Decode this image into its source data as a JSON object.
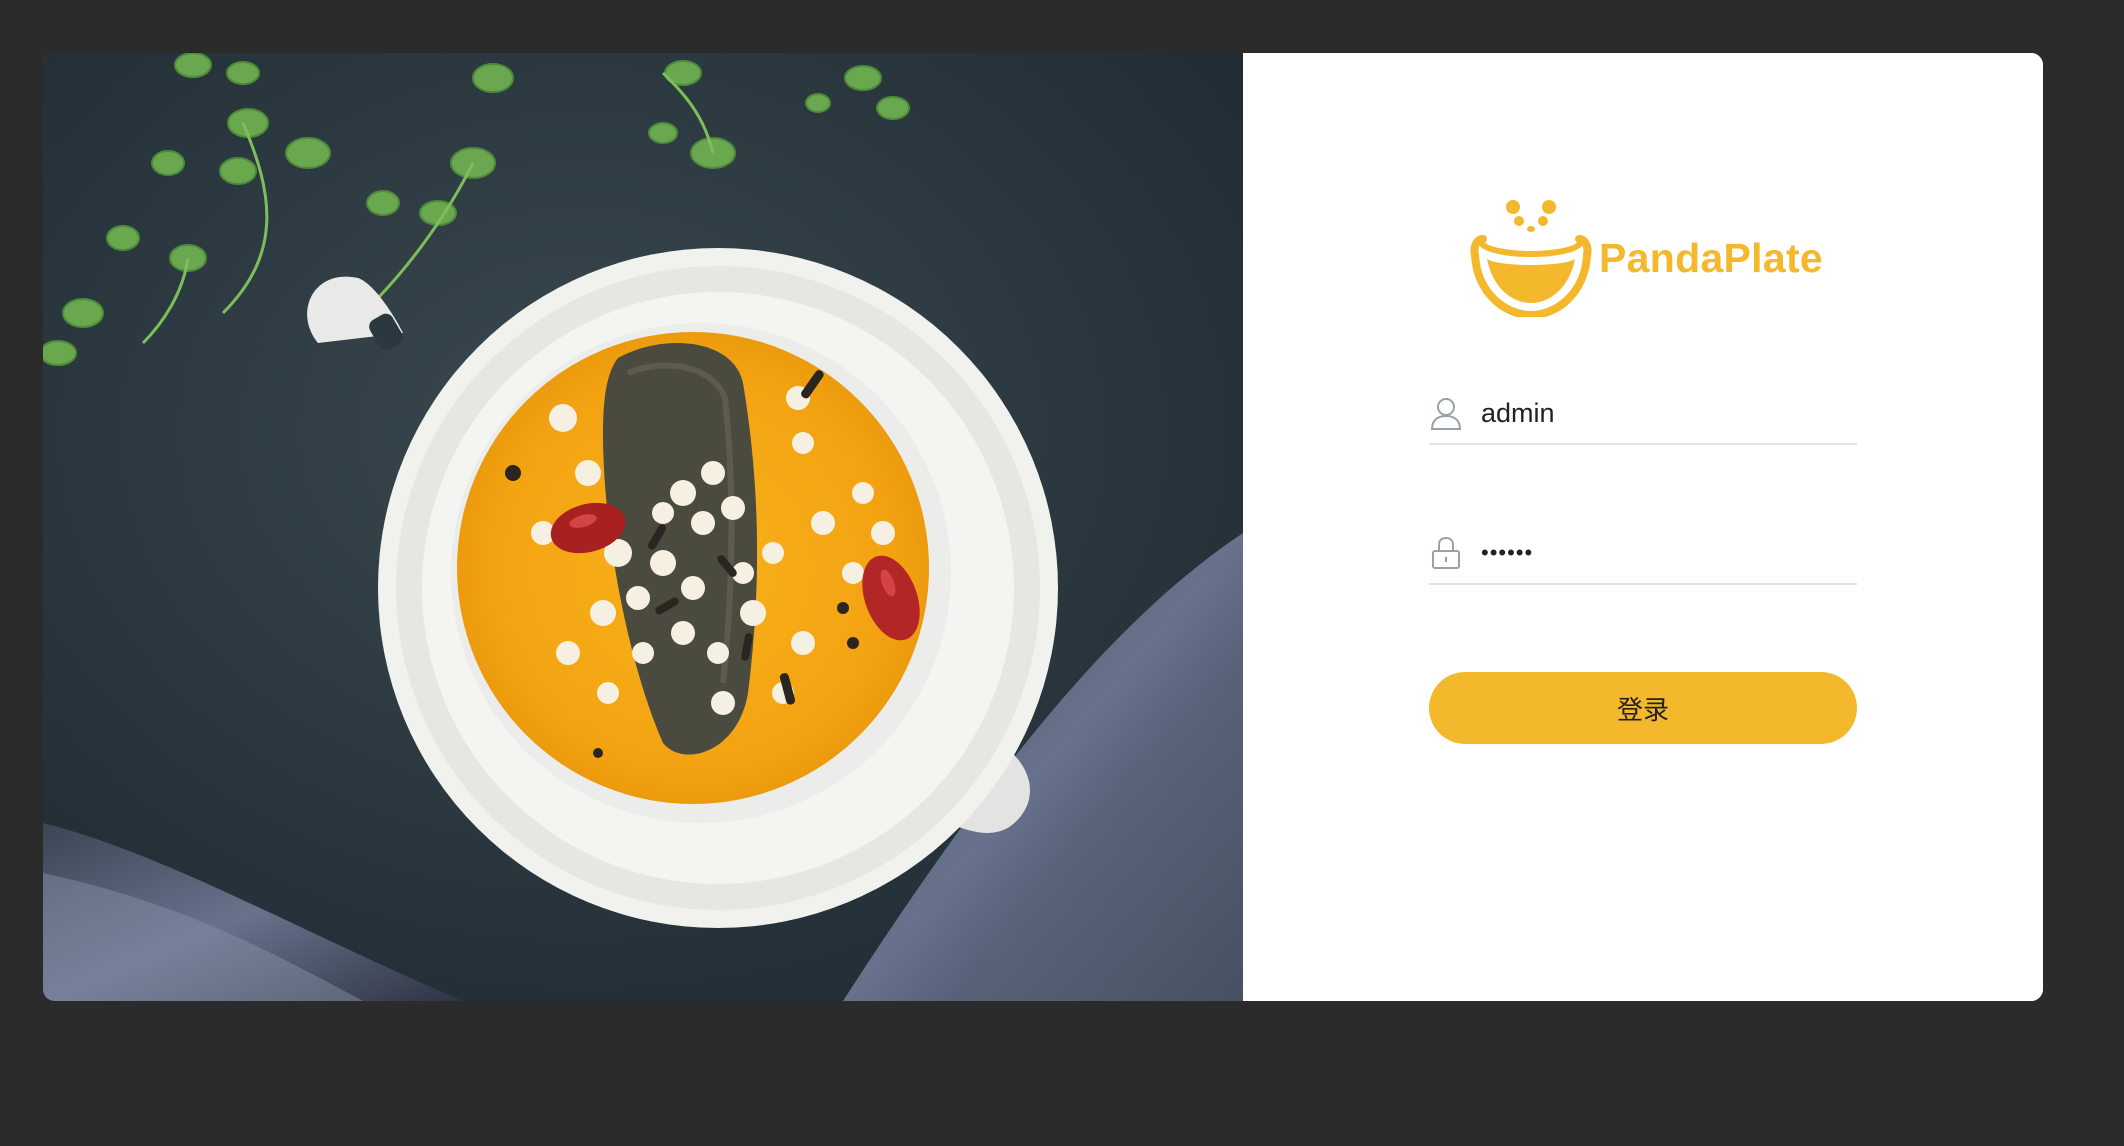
{
  "brand": {
    "name": "PandaPlate",
    "color": "#f3b82b"
  },
  "hero": {
    "image": "soup-bowl-photo"
  },
  "form": {
    "username": {
      "value": "admin",
      "icon": "user-icon"
    },
    "password": {
      "value": "••••••",
      "icon": "lock-icon"
    },
    "submit_label": "登录",
    "submit_color": "#f3b82c"
  }
}
